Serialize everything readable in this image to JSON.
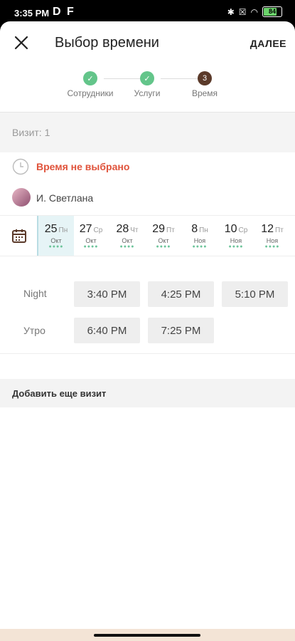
{
  "status": {
    "time": "3:35 PM",
    "apps": "D F",
    "battery": "84",
    "battery_fraction": 0.84
  },
  "header": {
    "title": "Выбор времени",
    "next_label": "ДАЛЕЕ",
    "close_icon": "close-icon"
  },
  "steps": [
    {
      "label": "Сотрудники",
      "state": "done"
    },
    {
      "label": "Услуги",
      "state": "done"
    },
    {
      "label": "Время",
      "number": "3",
      "state": "current"
    }
  ],
  "colors": {
    "accent_green": "#63c58a",
    "current_step": "#5b3a2a",
    "error": "#e0533b",
    "selected_date_bg": "#e6f4f6"
  },
  "visit": {
    "label": "Визит: 1",
    "time_text": "Время не выбрано",
    "staff_name": "И. Светлана"
  },
  "dates": [
    {
      "day": "25",
      "weekday": "Пн",
      "month": "Окт",
      "selected": true
    },
    {
      "day": "27",
      "weekday": "Ср",
      "month": "Окт"
    },
    {
      "day": "28",
      "weekday": "Чт",
      "month": "Окт"
    },
    {
      "day": "29",
      "weekday": "Пт",
      "month": "Окт"
    },
    {
      "day": "8",
      "weekday": "Пн",
      "month": "Ноя"
    },
    {
      "day": "10",
      "weekday": "Ср",
      "month": "Ноя"
    },
    {
      "day": "12",
      "weekday": "Пт",
      "month": "Ноя"
    }
  ],
  "slots": {
    "night_label": "Night",
    "night_times": [
      "3:40 PM",
      "4:25 PM",
      "5:10 PM"
    ],
    "morning_label": "Утро",
    "morning_times": [
      "6:40 PM",
      "7:25 PM"
    ]
  },
  "add_visit_label": "Добавить еще визит"
}
